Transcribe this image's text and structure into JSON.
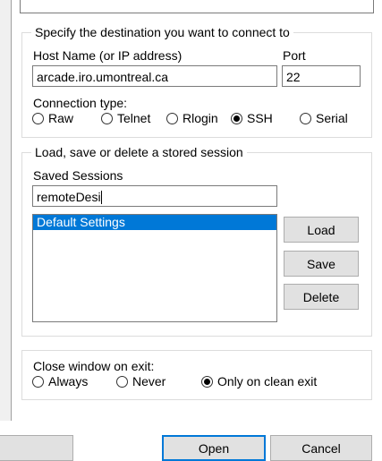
{
  "session": {
    "destination_legend": "Specify the destination you want to connect to",
    "host_label": "Host Name (or IP address)",
    "host_value": "arcade.iro.umontreal.ca",
    "port_label": "Port",
    "port_value": "22",
    "connection_type_label": "Connection type:",
    "connection_types": [
      {
        "label": "Raw",
        "checked": false
      },
      {
        "label": "Telnet",
        "checked": false
      },
      {
        "label": "Rlogin",
        "checked": false
      },
      {
        "label": "SSH",
        "checked": true
      },
      {
        "label": "Serial",
        "checked": false
      }
    ],
    "sessions_legend": "Load, save or delete a stored session",
    "saved_sessions_label": "Saved Sessions",
    "saved_sessions_value": "remoteDesi",
    "sessions_list": [
      "Default Settings"
    ],
    "selected_session": "Default Settings",
    "load_label": "Load",
    "save_label": "Save",
    "delete_label": "Delete",
    "close_window_label": "Close window on exit:",
    "close_options": [
      {
        "label": "Always",
        "checked": false
      },
      {
        "label": "Never",
        "checked": false
      },
      {
        "label": "Only on clean exit",
        "checked": true
      }
    ]
  },
  "footer": {
    "open_label": "Open",
    "cancel_label": "Cancel"
  },
  "colors": {
    "selection": "#0078d7",
    "button_face": "#e1e1e1",
    "group_border": "#dcdcdc"
  }
}
